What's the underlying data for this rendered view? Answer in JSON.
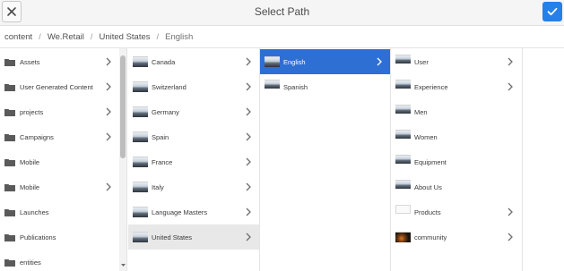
{
  "header": {
    "title": "Select Path",
    "close_icon": "close-icon",
    "confirm_icon": "checkmark-icon",
    "accent_color": "#2680eb"
  },
  "breadcrumb": {
    "items": [
      "content",
      "We.Retail",
      "United States",
      "English"
    ]
  },
  "columns": [
    {
      "items": [
        {
          "label": "Assets",
          "has_children": true
        },
        {
          "label": "User Generated Content",
          "has_children": true
        },
        {
          "label": "projects",
          "has_children": true
        },
        {
          "label": "Campaigns",
          "has_children": true
        },
        {
          "label": "Mobile",
          "has_children": false
        },
        {
          "label": "Mobile",
          "has_children": true
        },
        {
          "label": "Launches",
          "has_children": false
        },
        {
          "label": "Publications",
          "has_children": false
        },
        {
          "label": "entities",
          "has_children": false
        }
      ]
    },
    {
      "items": [
        {
          "label": "Canada",
          "has_children": true
        },
        {
          "label": "Switzerland",
          "has_children": true
        },
        {
          "label": "Germany",
          "has_children": true
        },
        {
          "label": "Spain",
          "has_children": true
        },
        {
          "label": "France",
          "has_children": true
        },
        {
          "label": "Italy",
          "has_children": true
        },
        {
          "label": "Language Masters",
          "has_children": true
        },
        {
          "label": "United States",
          "has_children": true,
          "selected": true
        }
      ]
    },
    {
      "items": [
        {
          "label": "English",
          "has_children": true,
          "active": true
        },
        {
          "label": "Spanish",
          "has_children": false
        }
      ]
    },
    {
      "items": [
        {
          "label": "User",
          "has_children": true
        },
        {
          "label": "Experience",
          "has_children": true
        },
        {
          "label": "Men",
          "has_children": false
        },
        {
          "label": "Women",
          "has_children": false
        },
        {
          "label": "Equipment",
          "has_children": false
        },
        {
          "label": "About Us",
          "has_children": false
        },
        {
          "label": "Products",
          "has_children": true
        },
        {
          "label": "community",
          "has_children": true
        }
      ]
    }
  ]
}
